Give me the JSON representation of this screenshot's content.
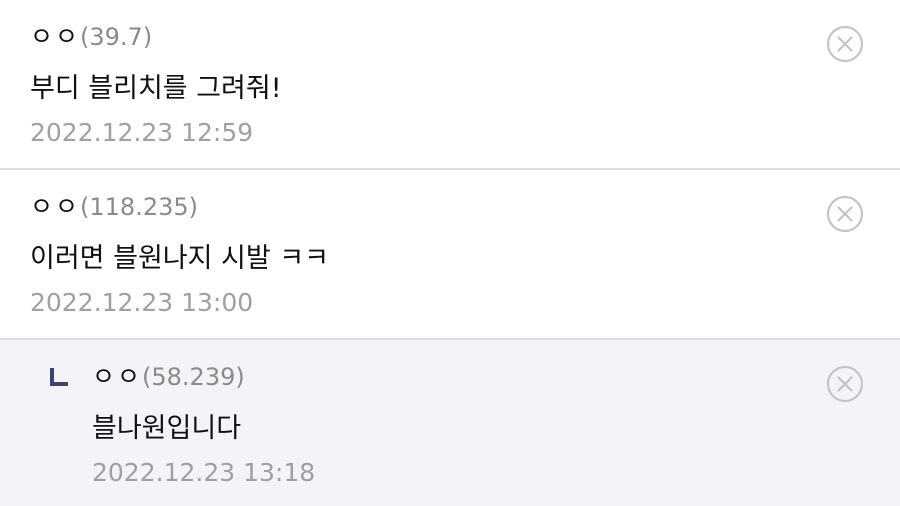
{
  "comments": [
    {
      "nick": "ㅇㅇ",
      "ip": "(39.7)",
      "body": "부디 블리치를 그려줘!",
      "timestamp": "2022.12.23 12:59"
    },
    {
      "nick": "ㅇㅇ",
      "ip": "(118.235)",
      "body": "이러면 블원나지 시발 ㅋㅋ",
      "timestamp": "2022.12.23 13:00"
    }
  ],
  "reply": {
    "nick": "ㅇㅇ",
    "ip": "(58.239)",
    "body": "블나원입니다",
    "timestamp": "2022.12.23 13:18"
  },
  "icons": {
    "delete": "close-circle-icon",
    "reply_marker": "reply-arrow-icon"
  },
  "colors": {
    "reply_marker": "#3b4376",
    "reply_background": "#f4f4f8",
    "meta_gray": "#a0a0a0"
  }
}
